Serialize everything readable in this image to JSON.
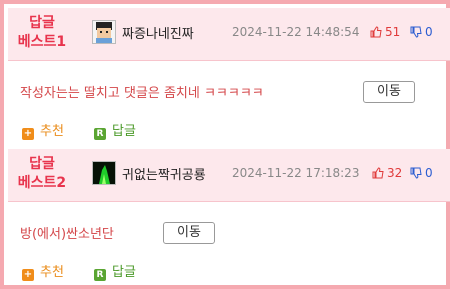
{
  "posts": [
    {
      "badge_line1": "답글",
      "badge_line2": "베스트1",
      "username": "짜증나네진짜",
      "timestamp": "2024-11-22 14:48:54",
      "likes": "51",
      "dislikes": "0",
      "content": "작성자는는 딸치고 댓글은 좀치네 ㅋㅋㅋㅋㅋ",
      "move_label": "이동",
      "recommend_label": "추천",
      "reply_label": "답글"
    },
    {
      "badge_line1": "답글",
      "badge_line2": "베스트2",
      "username": "귀없는짝귀공룡",
      "timestamp": "2024-11-22 17:18:23",
      "likes": "32",
      "dislikes": "0",
      "content": "방(에서)싼소년단",
      "move_label": "이동",
      "recommend_label": "추천",
      "reply_label": "답글"
    }
  ],
  "icons": {
    "recommend": "plus-square-icon",
    "reply": "r-square-icon",
    "like": "thumbs-up-icon",
    "dislike": "thumbs-down-icon"
  },
  "colors": {
    "border": "#f5a9b0",
    "header_bg": "#fde8ec",
    "badge": "#e8344d",
    "like": "#e03b3b",
    "dislike": "#2c5dd1",
    "recommend": "#f08d1a",
    "reply": "#5aa532"
  }
}
